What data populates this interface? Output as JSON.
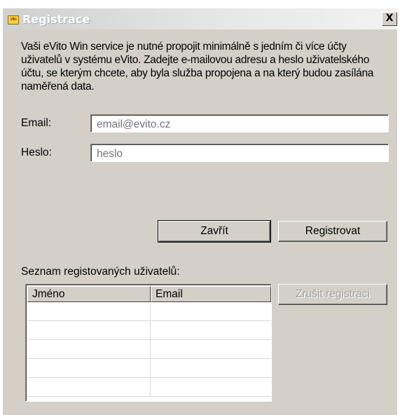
{
  "window": {
    "title": "Registrace",
    "icon_text": "vito",
    "close_label": "X"
  },
  "intro_text": "Vaši eVito Win service je nutné propojit minimálně s jedním či více účty uživatelů v systému eVito. Zadejte e-mailovou adresu a heslo uživatelského účtu, se kterým chcete, aby byla služba propojena a na který budou zasílána naměřená data.",
  "form": {
    "email_label": "Email:",
    "email_placeholder": "email@evito.cz",
    "password_label": "Heslo:",
    "password_placeholder": "heslo"
  },
  "buttons": {
    "close": "Zavřít",
    "register": "Registrovat",
    "unregister": "Zrušit registraci"
  },
  "users_list": {
    "label": "Seznam registovaných uživatelů:",
    "columns": [
      "Jméno",
      "Email"
    ],
    "rows": [
      [
        "",
        ""
      ],
      [
        "",
        ""
      ],
      [
        "",
        ""
      ],
      [
        "",
        ""
      ],
      [
        "",
        ""
      ]
    ]
  },
  "colors": {
    "window_bg": "#d4d0c8",
    "title_text": "#ffffff",
    "placeholder_text": "#a0a0a0",
    "disabled_text": "#a0a0a0"
  }
}
